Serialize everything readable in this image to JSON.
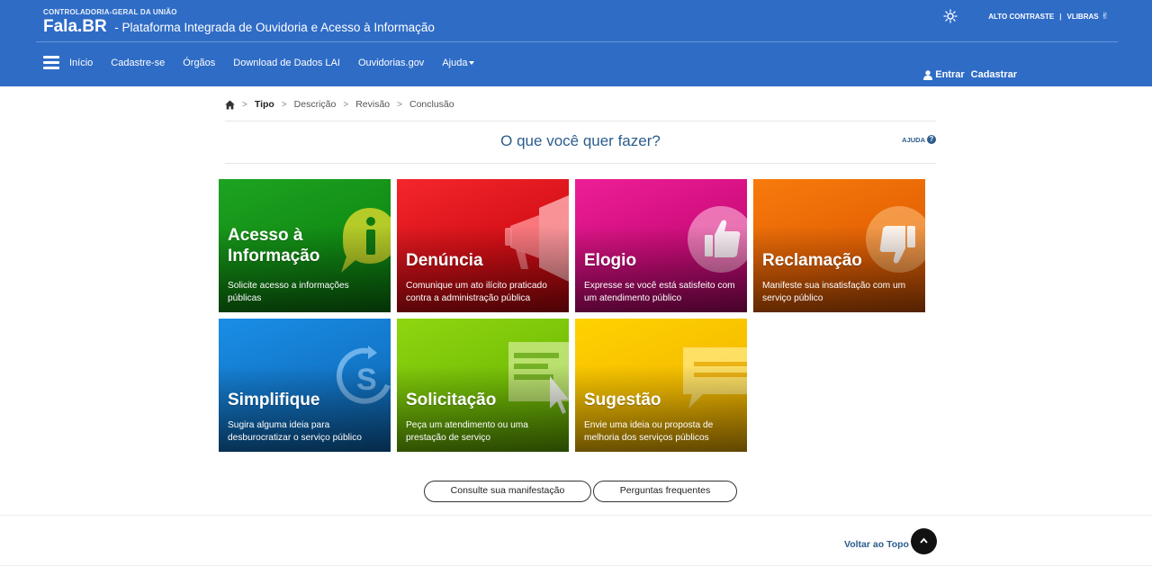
{
  "header": {
    "org": "CONTROLADORIA-GERAL DA UNIÃO",
    "logo": "Fala.BR",
    "subtitle": "- Plataforma Integrada de Ouvidoria e Acesso à Informação",
    "high_contrast": "ALTO CONTRASTE",
    "separator": "|",
    "vlibras": "VLIBRAS",
    "icons": {
      "theme": "sun-icon",
      "vlibras": "hand-icon",
      "menu": "hamburger-icon",
      "user": "user-icon"
    }
  },
  "nav": {
    "items": [
      "Início",
      "Cadastre-se",
      "Órgãos",
      "Download de Dados LAI",
      "Ouvidorias.gov"
    ],
    "dropdown": "Ajuda",
    "login": "Entrar",
    "register": "Cadastrar"
  },
  "breadcrumb": {
    "chevron": ">",
    "steps": [
      "Tipo",
      "Descrição",
      "Revisão",
      "Conclusão"
    ]
  },
  "main": {
    "question": "O que você quer fazer?",
    "help": "AJUDA",
    "help_icon": "?"
  },
  "cards": [
    {
      "title_lines": [
        "Acesso à",
        "Informação"
      ],
      "desc": "Solicite acesso a informações públicas",
      "color": "#118c14"
    },
    {
      "title_lines": [
        "Denúncia"
      ],
      "desc": "Comunique um ato ilícito praticado contra a administração pública",
      "color": "#d40f16"
    },
    {
      "title_lines": [
        "Elogio"
      ],
      "desc": "Expresse se você está satisfeito com um atendimento público",
      "color": "#cc0c7a"
    },
    {
      "title_lines": [
        "Reclamação"
      ],
      "desc": "Manifeste sua insatisfação com um serviço público",
      "color": "#e56204"
    },
    {
      "title_lines": [
        "Simplifique"
      ],
      "desc": "Sugira alguma ideia para desburocratizar o serviço público",
      "color": "#1275c6"
    },
    {
      "title_lines": [
        "Solicitação"
      ],
      "desc": "Peça um atendimento ou uma prestação de serviço",
      "color": "#74bf06"
    },
    {
      "title_lines": [
        "Sugestão"
      ],
      "desc": "Envie uma ideia ou proposta de melhoria dos serviços públicos",
      "color": "#f5bd00"
    }
  ],
  "buttons": {
    "consulte": "Consulte sua manifestação",
    "faq": "Perguntas frequentes"
  },
  "footer": {
    "back_to_top": "Voltar ao Topo"
  },
  "colors": {
    "header": "#2f6cc6",
    "link": "#2b5d8c"
  }
}
